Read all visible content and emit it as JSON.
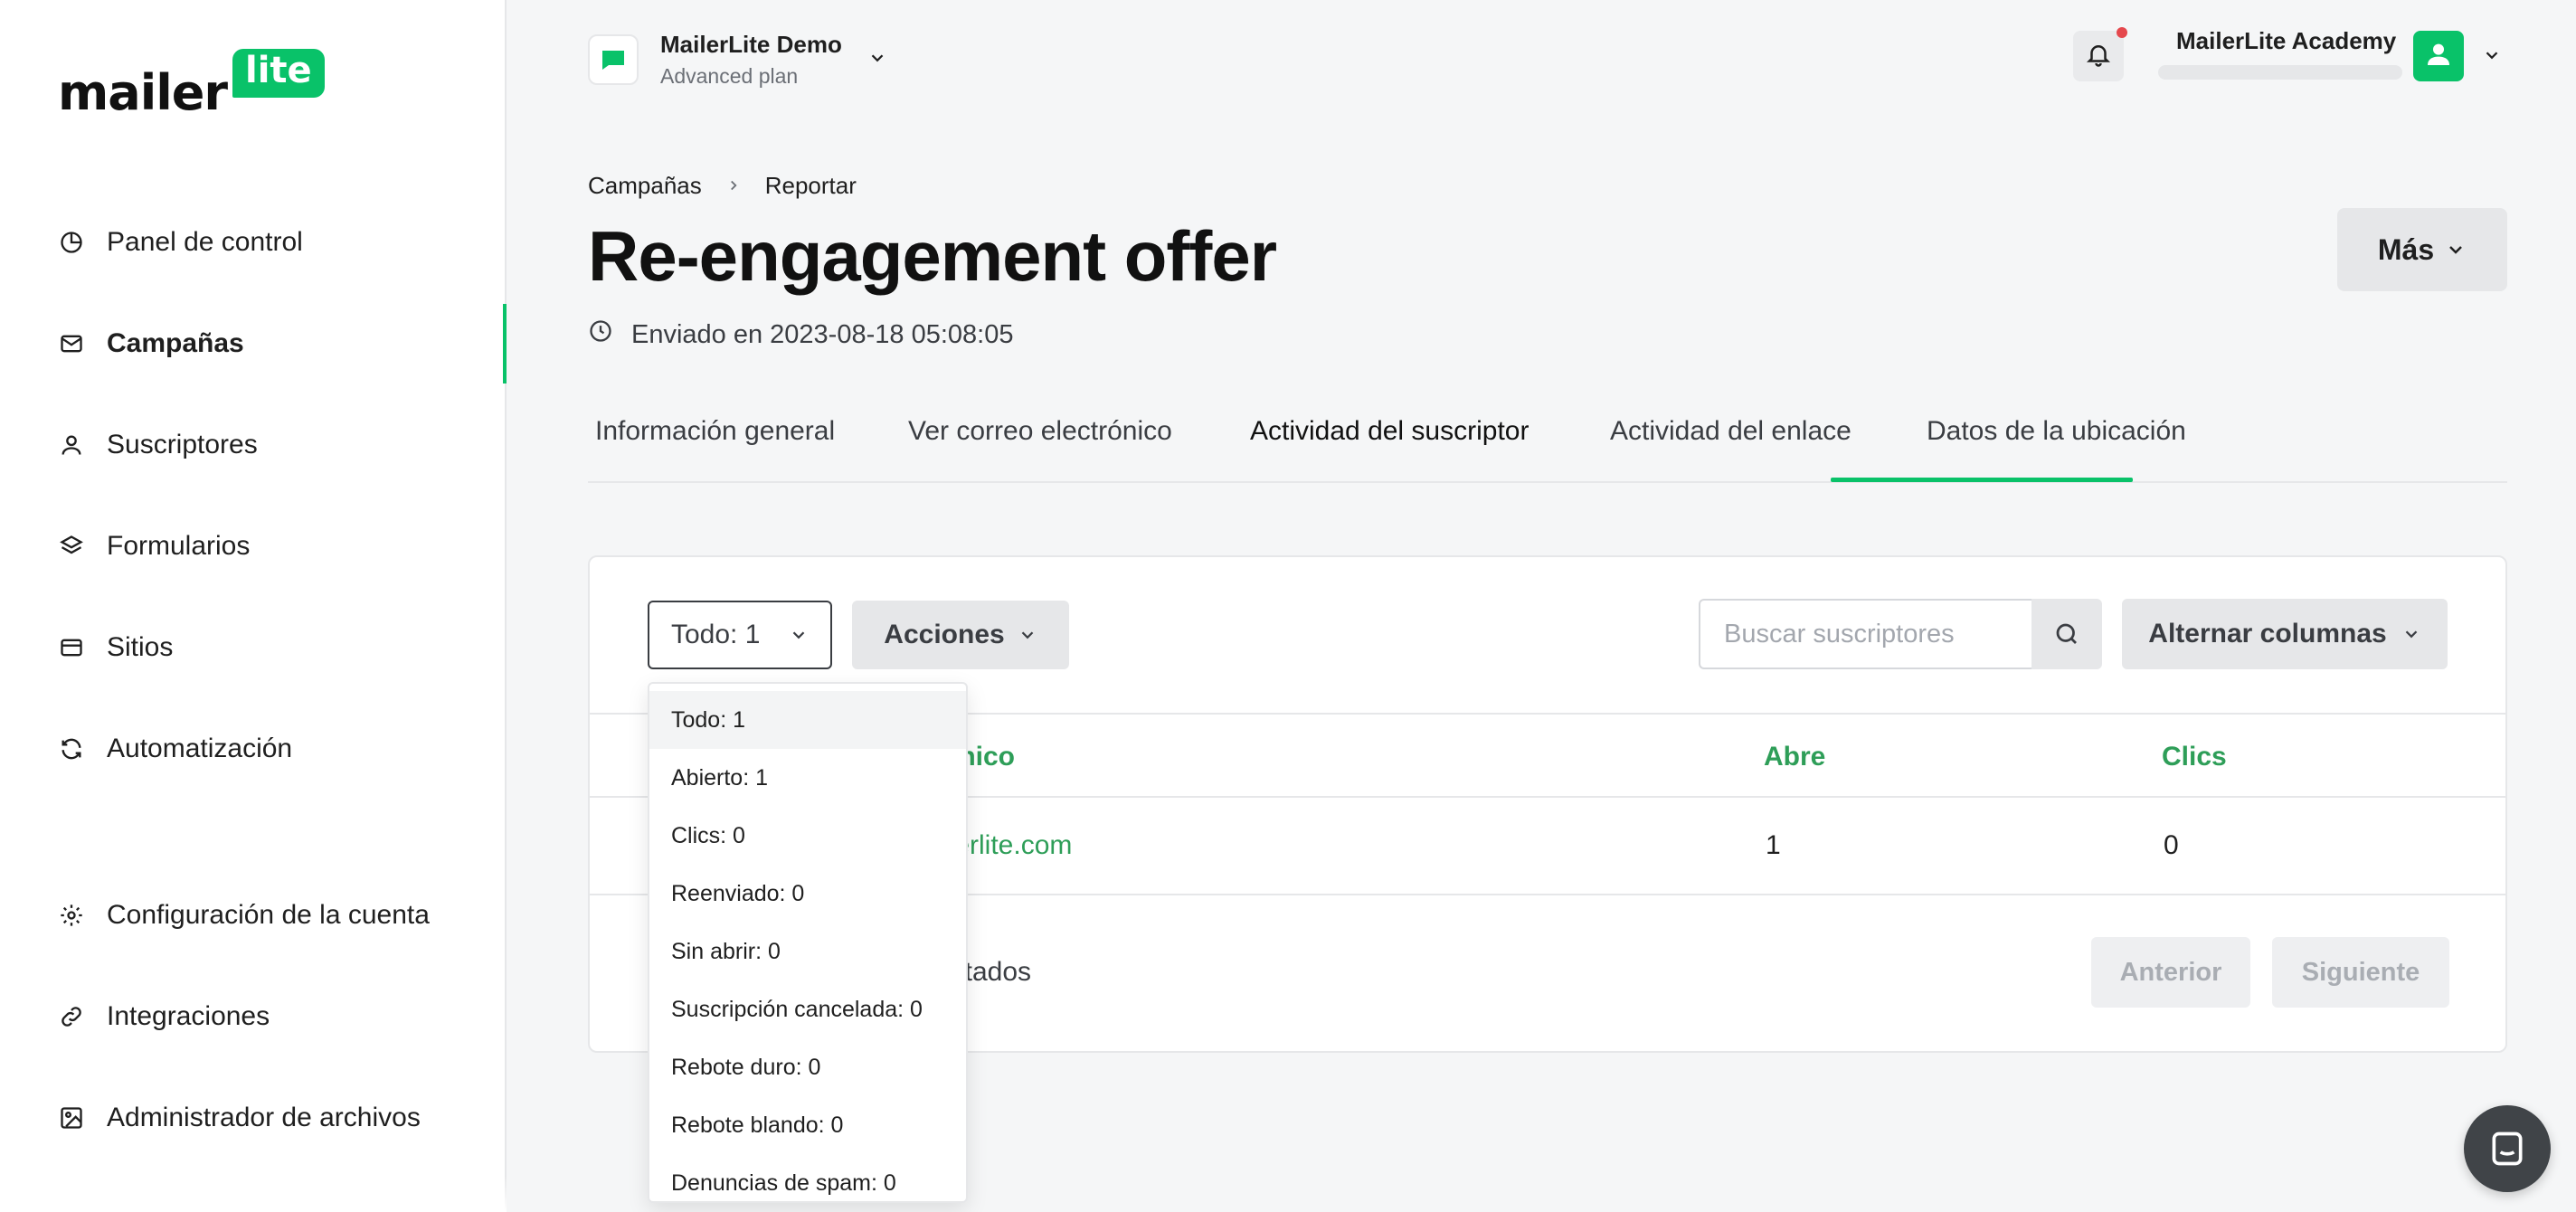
{
  "brand": {
    "word": "mailer",
    "pill": "lite"
  },
  "sidebar": {
    "items": [
      {
        "label": "Panel de control",
        "icon": "pie-chart-icon"
      },
      {
        "label": "Campañas",
        "icon": "mail-icon"
      },
      {
        "label": "Suscriptores",
        "icon": "user-icon"
      },
      {
        "label": "Formularios",
        "icon": "layers-icon"
      },
      {
        "label": "Sitios",
        "icon": "browser-icon"
      },
      {
        "label": "Automatización",
        "icon": "refresh-icon"
      },
      {
        "label": "Configuración de la cuenta",
        "icon": "gear-icon"
      },
      {
        "label": "Integraciones",
        "icon": "link-icon"
      },
      {
        "label": "Administrador de archivos",
        "icon": "image-icon"
      }
    ],
    "active": "Campañas"
  },
  "account": {
    "name": "MailerLite Demo",
    "plan": "Advanced plan"
  },
  "user": {
    "name": "MailerLite Academy"
  },
  "breadcrumb": {
    "parent": "Campañas",
    "current": "Reportar"
  },
  "campaign": {
    "title": "Re-engagement offer",
    "sent": "Enviado en 2023-08-18 05:08:05"
  },
  "header": {
    "more_label": "Más"
  },
  "tabs": [
    {
      "label": "Información general"
    },
    {
      "label": "Ver correo electrónico"
    },
    {
      "label": "Actividad del suscriptor"
    },
    {
      "label": "Actividad del enlace"
    },
    {
      "label": "Datos de la ubicación"
    }
  ],
  "active_tab": "Actividad del suscriptor",
  "toolbar": {
    "filter_value": "Todo: 1",
    "actions_label": "Acciones",
    "search_placeholder": "Buscar suscriptores",
    "columns_label": "Alternar columnas"
  },
  "table": {
    "columns": [
      "ónico",
      "Abre",
      "Clics"
    ],
    "rows": [
      {
        "email": "ilerlite.com",
        "opens": "1",
        "clicks": "0"
      }
    ],
    "results_text": "ltados",
    "prev_label": "Anterior",
    "next_label": "Siguiente"
  },
  "filter_menu": {
    "options": [
      "Todo: 1",
      "Abierto: 1",
      "Clics: 0",
      "Reenviado: 0",
      "Sin abrir: 0",
      "Suscripción cancelada: 0",
      "Rebote duro: 0",
      "Rebote blando: 0",
      "Denuncias de spam: 0"
    ],
    "selected": "Todo: 1"
  },
  "colors": {
    "accent": "#09c269",
    "link": "#2e9e58"
  }
}
